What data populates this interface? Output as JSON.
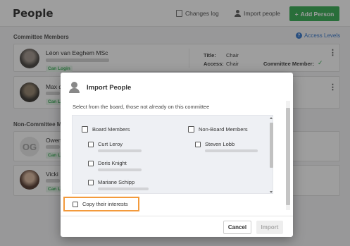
{
  "header": {
    "title": "People",
    "changes_log": "Changes log",
    "import_people": "Import people",
    "add_person": "Add Person"
  },
  "sections": {
    "committee": "Committee Members",
    "non_committee": "Non-Committee Members",
    "access_levels": "Access Levels"
  },
  "members": [
    {
      "name": "Léon van Eeghem MSc",
      "badge": "Can Login",
      "title_key": "Title:",
      "title_val": "Chair",
      "access_key": "Access:",
      "access_val": "Chair",
      "committee_member": "Committee Member:"
    },
    {
      "name": "Max d",
      "badge": "Can L"
    }
  ],
  "non_members": [
    {
      "name": "Owen",
      "initials": "OG",
      "badge": "Can L"
    },
    {
      "name": "Vicki",
      "badge": "Can L"
    }
  ],
  "modal": {
    "title": "Import People",
    "instruction": "Select from the board, those not already on this committee",
    "groups": {
      "board": "Board Members",
      "non_board": "Non-Board Members"
    },
    "board_members": [
      "Curt Leroy",
      "Doris Knight",
      "Mariane Schipp"
    ],
    "non_board_members": [
      "Steven Lobb"
    ],
    "copy_interests": "Copy their interests",
    "cancel": "Cancel",
    "import": "Import"
  },
  "colors": {
    "accent_green": "#2aa84a",
    "link_blue": "#2a6fc9",
    "highlight_orange": "#f39a3c"
  }
}
